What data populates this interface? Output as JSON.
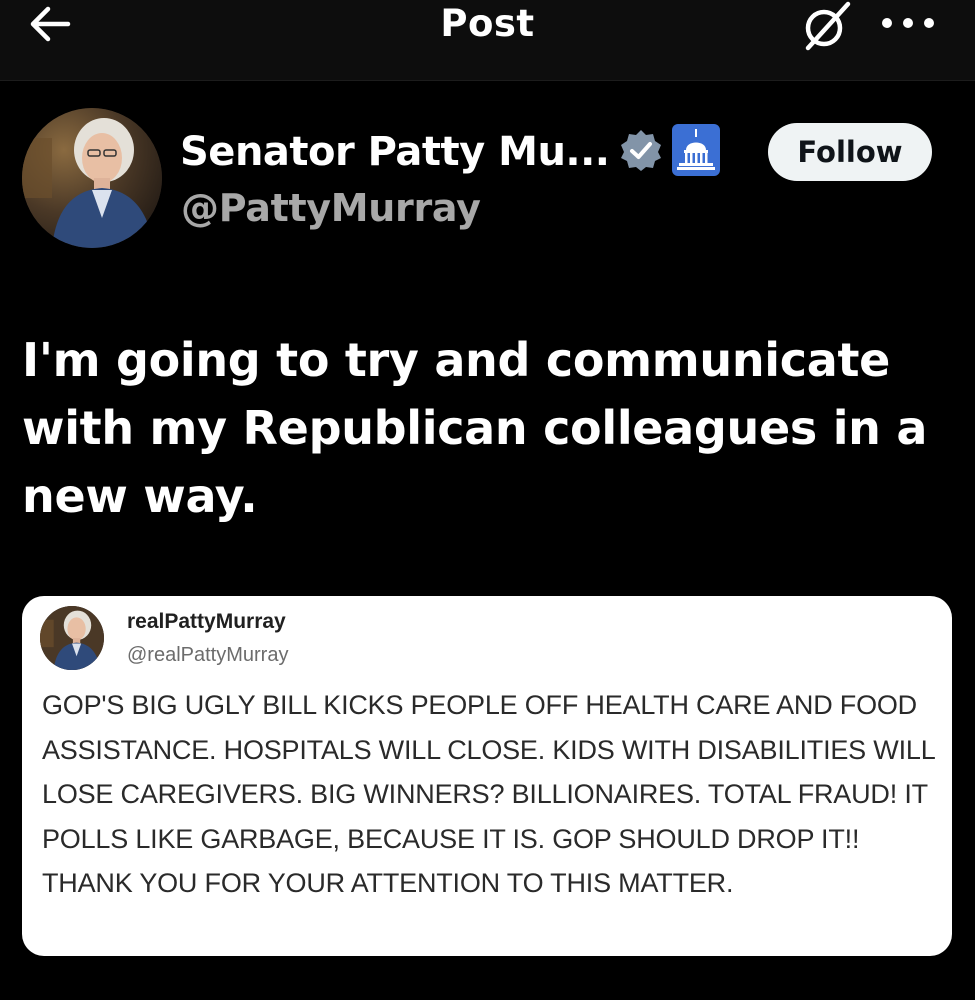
{
  "header": {
    "title": "Post",
    "back_icon": "arrow-left-icon",
    "grok_icon": "grok-icon",
    "more_icon": "more-horizontal-icon"
  },
  "author": {
    "display_name": "Senator Patty Mu...",
    "handle": "@PattyMurray",
    "verified_badge_icon": "verified-badge-icon",
    "affiliation_icon": "capitol-building-icon",
    "follow_label": "Follow"
  },
  "tweet": {
    "text": "I'm going to try and communicate with my Republican colleagues in a new way."
  },
  "embedded_post": {
    "name": "realPattyMurray",
    "handle": "@realPattyMurray",
    "text": "GOP'S BIG UGLY BILL KICKS PEOPLE OFF HEALTH CARE AND FOOD ASSISTANCE. HOSPITALS WILL CLOSE. KIDS WITH DISABILITIES WILL LOSE CAREGIVERS. BIG WINNERS? BILLIONAIRES. TOTAL FRAUD! IT POLLS LIKE GARBAGE, BECAUSE IT IS. GOP SHOULD DROP IT!! THANK YOU FOR YOUR ATTENTION TO THIS MATTER."
  },
  "colors": {
    "background": "#000000",
    "header_background": "#0d0d0d",
    "text_primary": "#ffffff",
    "text_secondary": "#a8a8a8",
    "verified_badge": "#8294a8",
    "affiliation_badge": "#3b6fd4",
    "follow_button_bg": "#eff3f4",
    "card_background": "#ffffff"
  }
}
